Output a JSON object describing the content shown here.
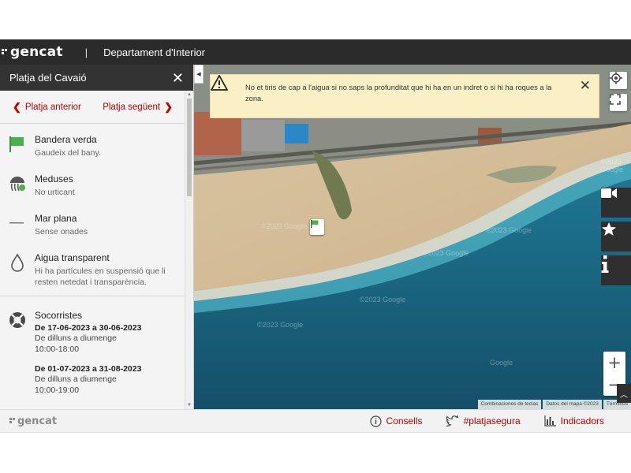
{
  "header": {
    "logo": "gencat",
    "divider": "|",
    "department": "Departament d'Interior"
  },
  "panel": {
    "title": "Platja del Cavaió",
    "prev_label": "Platja anterior",
    "next_label": "Platja següent",
    "status": [
      {
        "icon": "green-flag-icon",
        "title": "Bandera verda",
        "subtitle": "Gaudeix del bany."
      },
      {
        "icon": "jellyfish-icon",
        "title": "Meduses",
        "subtitle": "No urticant"
      },
      {
        "icon": "calm-sea-icon",
        "title": "Mar plana",
        "subtitle": "Sense onades"
      },
      {
        "icon": "water-drop-icon",
        "title": "Aigua transparent",
        "subtitle": "Hi ha partícules en suspensió que li resten netedat i transparència."
      }
    ],
    "lifeguards": {
      "icon": "lifebuoy-icon",
      "title": "Socorristes",
      "periods": [
        {
          "dates": "De 17-06-2023 a 30-06-2023",
          "days": "De dilluns a diumenge",
          "hours": "10:00-18:00"
        },
        {
          "dates": "De 01-07-2023 a 31-08-2023",
          "days": "De dilluns a diumenge",
          "hours": "10:00-19:00"
        }
      ]
    }
  },
  "map": {
    "alert": "No et tiris de cap a l'aigua si no saps la profunditat que hi ha en un indret o si hi ha roques a la zona.",
    "zoom_in": "+",
    "zoom_out": "−",
    "attribution": [
      "Combinaciones de teclas",
      "Datos del mapa ©2023",
      "Términos"
    ],
    "watermarks": [
      "©2023 Google",
      "©2023 Google",
      "©2023 Google",
      "©2023 Google",
      "©2023 Google",
      "Google",
      "©2023 Google"
    ]
  },
  "footer": {
    "logo": "gencat",
    "links": [
      {
        "icon": "info-icon",
        "label": "Consells"
      },
      {
        "icon": "twitter-icon",
        "label": "#platjasegura"
      },
      {
        "icon": "bar-chart-icon",
        "label": "Indicadors"
      }
    ]
  },
  "colors": {
    "accent": "#c00000",
    "header": "#2b2b2b",
    "alert_bg": "#fbf0c5",
    "flag_green": "#4caf50"
  }
}
